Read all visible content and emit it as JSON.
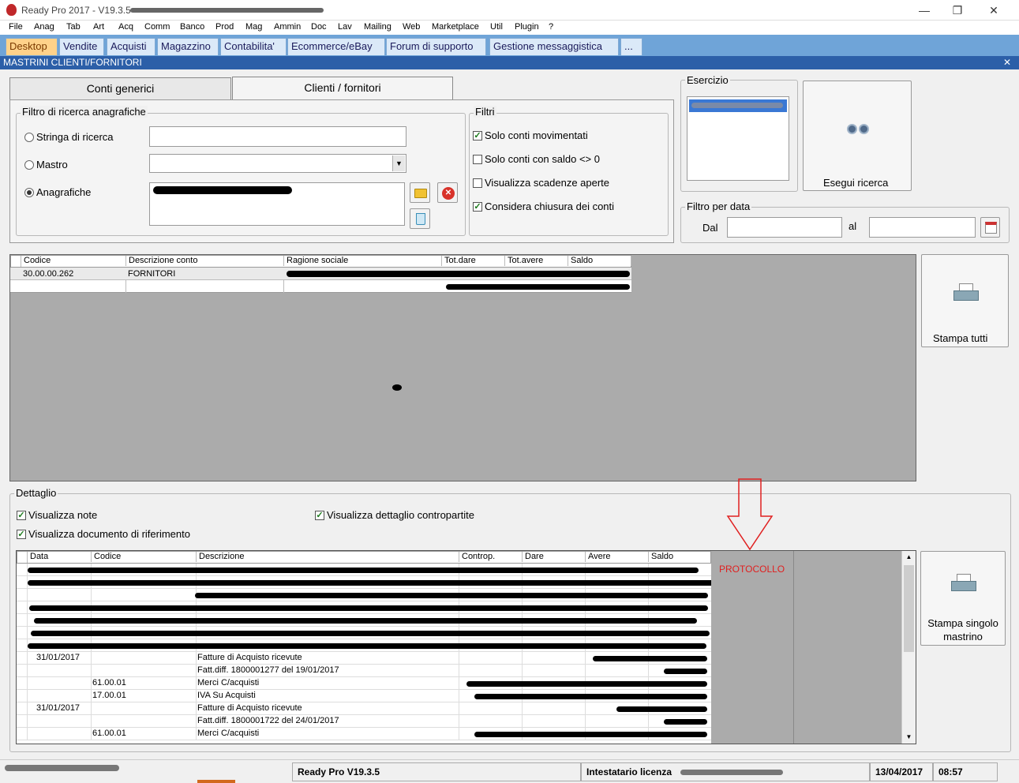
{
  "window": {
    "title": "Ready Pro 2017 - V19.3.5 -",
    "minimize": "—",
    "maximize": "❐",
    "close": "✕"
  },
  "menu": [
    "File",
    "Anag",
    "Tab",
    "Art",
    "Acq",
    "Comm",
    "Banco",
    "Prod",
    "Mag",
    "Ammin",
    "Doc",
    "Lav",
    "Mailing",
    "Web",
    "Marketplace",
    "Util",
    "Plugin",
    "?"
  ],
  "module_tabs": [
    "Desktop",
    "Vendite",
    "Acquisti",
    "Magazzino",
    "Contabilita'",
    "Ecommerce/eBay",
    "Forum di supporto",
    "Gestione messaggistica",
    "..."
  ],
  "section_title": "MASTRINI CLIENTI/FORNITORI",
  "section_close": "✕",
  "tabs": [
    "Conti generici",
    "Clienti / fornitori"
  ],
  "filtro_anagrafiche": {
    "legend": "Filtro di ricerca anagrafiche",
    "stringa": "Stringa di ricerca",
    "mastro": "Mastro",
    "anagrafiche": "Anagrafiche"
  },
  "filtri": {
    "legend": "Filtri",
    "items": [
      {
        "label": "Solo conti movimentati",
        "checked": true
      },
      {
        "label": "Solo conti con saldo <> 0",
        "checked": false
      },
      {
        "label": "Visualizza scadenze aperte",
        "checked": false
      },
      {
        "label": "Considera chiusura dei conti",
        "checked": true
      }
    ]
  },
  "esercizio": {
    "legend": "Esercizio",
    "button": "Esegui ricerca"
  },
  "filtro_data": {
    "legend": "Filtro per data",
    "dal": "Dal",
    "al": "al"
  },
  "conti_grid": {
    "headers": [
      "Codice",
      "Descrizione conto",
      "Ragione sociale",
      "Tot.dare",
      "Tot.avere",
      "Saldo"
    ],
    "rows": [
      [
        "30.00.00.262",
        "FORNITORI"
      ]
    ]
  },
  "stampa_tutti": "Stampa tutti",
  "dettaglio": {
    "legend": "Dettaglio",
    "checks": [
      "Visualizza note",
      "Visualizza documento di riferimento",
      "Visualizza dettaglio contropartite"
    ]
  },
  "dettaglio_grid": {
    "headers": [
      "Data",
      "Codice",
      "Descrizione",
      "Controp.",
      "Dare",
      "Avere",
      "Saldo"
    ],
    "rows": [
      {
        "data": "31/01/2017",
        "codice": "",
        "descr": "Fatture di Acquisto ricevute"
      },
      {
        "data": "",
        "codice": "",
        "descr": "Fatt.diff. 1800001277 del 19/01/2017"
      },
      {
        "data": "",
        "codice": "61.00.01",
        "descr": "Merci C/acquisti"
      },
      {
        "data": "",
        "codice": "17.00.01",
        "descr": "IVA Su Acquisti"
      },
      {
        "data": "31/01/2017",
        "codice": "",
        "descr": "Fatture di Acquisto ricevute"
      },
      {
        "data": "",
        "codice": "",
        "descr": "Fatt.diff. 1800001722 del 24/01/2017"
      },
      {
        "data": "",
        "codice": "61.00.01",
        "descr": "Merci C/acquisti"
      }
    ],
    "protocollo": "PROTOCOLLO"
  },
  "stampa_singolo": "Stampa singolo mastrino",
  "status": {
    "version": "Ready Pro V19.3.5",
    "intestatario": "Intestatario licenza",
    "date": "13/04/2017",
    "time": "08:57"
  },
  "colors": {
    "annotation_red": "#e02020",
    "tab_active": "#ffd28a",
    "section": "#2c5fa8"
  }
}
